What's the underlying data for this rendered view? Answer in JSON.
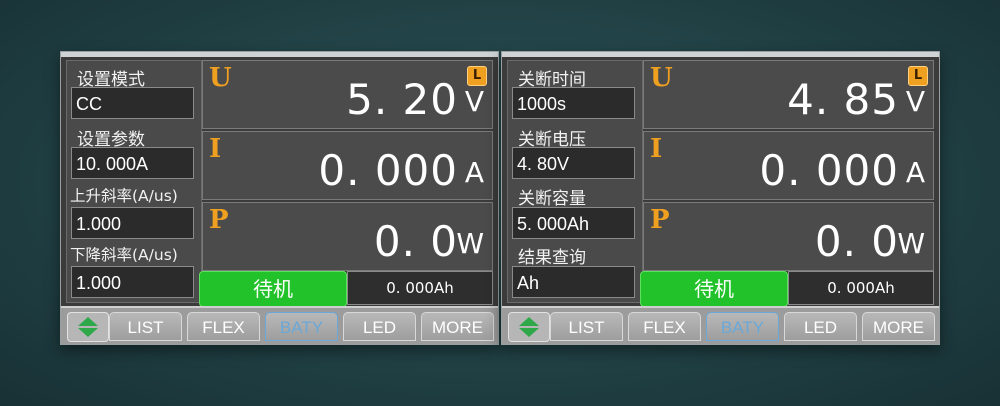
{
  "screens": [
    {
      "params": [
        {
          "label": "设置模式",
          "value": "CC"
        },
        {
          "label": "设置参数",
          "value": "10. 000A"
        },
        {
          "label": "上升斜率(A/us)",
          "value": "1.000"
        },
        {
          "label": "下降斜率(A/us)",
          "value": "1.000"
        }
      ],
      "lock_label": "L",
      "readings": {
        "u": {
          "letter": "U",
          "value": "5. 20",
          "unit": "V"
        },
        "i": {
          "letter": "I",
          "value": "0. 000",
          "unit": "A"
        },
        "p": {
          "letter": "P",
          "value": "0. 0",
          "unit": "W"
        }
      },
      "status_label": "待机",
      "ah_value": "0. 000Ah",
      "tabs": [
        "LIST",
        "FLEX",
        "BATY",
        "LED",
        "MORE"
      ],
      "active_tab": "BATY"
    },
    {
      "params": [
        {
          "label": "关断时间",
          "value": "1000s"
        },
        {
          "label": "关断电压",
          "value": "4. 80V"
        },
        {
          "label": "关断容量",
          "value": "5. 000Ah"
        },
        {
          "label": "结果查询",
          "value": "Ah"
        }
      ],
      "lock_label": "L",
      "readings": {
        "u": {
          "letter": "U",
          "value": "4. 85",
          "unit": "V"
        },
        "i": {
          "letter": "I",
          "value": "0. 000",
          "unit": "A"
        },
        "p": {
          "letter": "P",
          "value": "0. 0",
          "unit": "W"
        }
      },
      "status_label": "待机",
      "ah_value": "0. 000Ah",
      "tabs": [
        "LIST",
        "FLEX",
        "BATY",
        "LED",
        "MORE"
      ],
      "active_tab": "BATY"
    }
  ],
  "icons": [
    "lock-icon",
    "up-down-arrows-icon"
  ],
  "colors": {
    "accent": "#f0a020",
    "status_green": "#22c22a",
    "active_tab": "#6aa8d8",
    "panel_bg": "#4b4b4b"
  }
}
